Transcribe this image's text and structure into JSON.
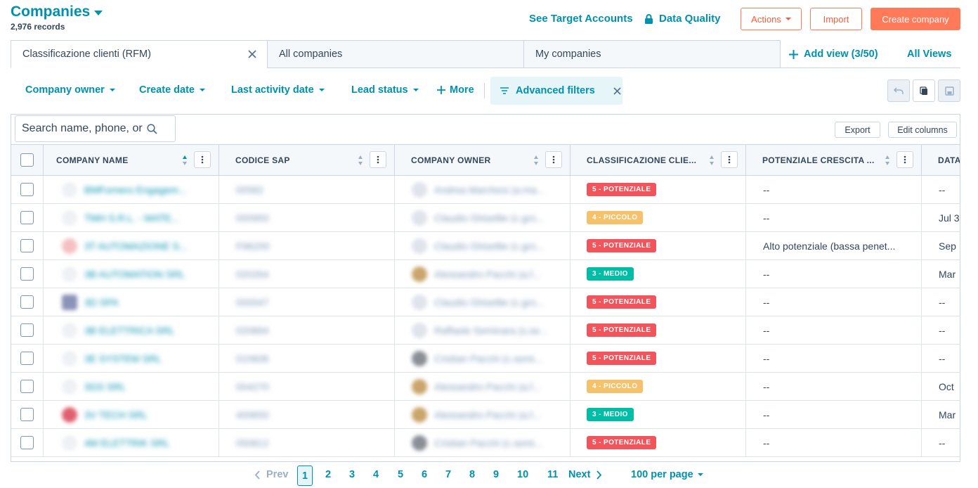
{
  "header": {
    "title": "Companies",
    "records": "2,976 records",
    "see_target": "See Target Accounts",
    "data_quality": "Data Quality",
    "actions": "Actions",
    "import": "Import",
    "create": "Create company"
  },
  "tabs": [
    {
      "label": "Classificazione clienti (RFM)"
    },
    {
      "label": "All companies"
    },
    {
      "label": "My companies"
    }
  ],
  "add_view": "Add view (3/50)",
  "all_views": "All Views",
  "filters": {
    "owner": "Company owner",
    "create_date": "Create date",
    "last_activity": "Last activity date",
    "lead_status": "Lead status",
    "more": "More",
    "advanced": "Advanced filters"
  },
  "table": {
    "search_placeholder": "Search name, phone, or",
    "export": "Export",
    "edit_columns": "Edit columns",
    "columns": [
      "COMPANY NAME",
      "CODICE SAP",
      "COMPANY OWNER",
      "CLASSIFICAZIONE CLIE...",
      "POTENZIALE CRESCITA ...",
      "DATA"
    ],
    "rows": [
      {
        "name": "BMFornero Engagem...",
        "sap": "00582",
        "owner": "Andrea Marchesi (a.ma...",
        "class": "5 - POTENZIALE",
        "pot": "--",
        "date": "--"
      },
      {
        "name": "TMH S.R.L. - MATE...",
        "sap": "000950",
        "owner": "Claudio Ghisellie (c.gro...",
        "class": "4 - PICCOLO",
        "pot": "--",
        "date": "Jul 3"
      },
      {
        "name": "3T AUTOMAZIONE S...",
        "sap": "F96200",
        "owner": "Claudio Ghisellie (c.gro...",
        "class": "5 - POTENZIALE",
        "pot": "Alto potenziale (bassa penet...",
        "date": "Sep"
      },
      {
        "name": "3B AUTOMATION SRL",
        "sap": "020264",
        "owner": "Alessandro Pacchi (a.f...",
        "class": "3 - MEDIO",
        "pot": "--",
        "date": "Mar"
      },
      {
        "name": "3D SPA",
        "sap": "000047",
        "owner": "Claudio Ghisellie (c.gro...",
        "class": "5 - POTENZIALE",
        "pot": "--",
        "date": "--"
      },
      {
        "name": "3B ELETTRICA SRL",
        "sap": "020894",
        "owner": "Raffaele Seminara (s.se...",
        "class": "5 - POTENZIALE",
        "pot": "--",
        "date": "--"
      },
      {
        "name": "3E SYSTEM SRL",
        "sap": "010606",
        "owner": "Cristian Pacchi (c.semi...",
        "class": "5 - POTENZIALE",
        "pot": "--",
        "date": "--"
      },
      {
        "name": "3GS SRL",
        "sap": "004270",
        "owner": "Alessandro Pacchi (a.f...",
        "class": "4 - PICCOLO",
        "pot": "--",
        "date": "Oct"
      },
      {
        "name": "3V TECH SRL",
        "sap": "400650",
        "owner": "Alessandro Pacchi (a.f...",
        "class": "3 - MEDIO",
        "pot": "--",
        "date": "Mar"
      },
      {
        "name": "4M ELETTRIK SRL",
        "sap": "050612",
        "owner": "Cristian Pacchi (c.semi...",
        "class": "5 - POTENZIALE",
        "pot": "--",
        "date": "--"
      }
    ]
  },
  "badge_colors": {
    "5 - POTENZIALE": "#f2545b",
    "4 - PICCOLO": "#f5c26b",
    "3 - MEDIO": "#00bda5"
  },
  "pagination": {
    "prev": "Prev",
    "pages": [
      "1",
      "2",
      "3",
      "4",
      "5",
      "6",
      "7",
      "8",
      "9",
      "10",
      "11"
    ],
    "next": "Next",
    "per_page": "100 per page"
  }
}
